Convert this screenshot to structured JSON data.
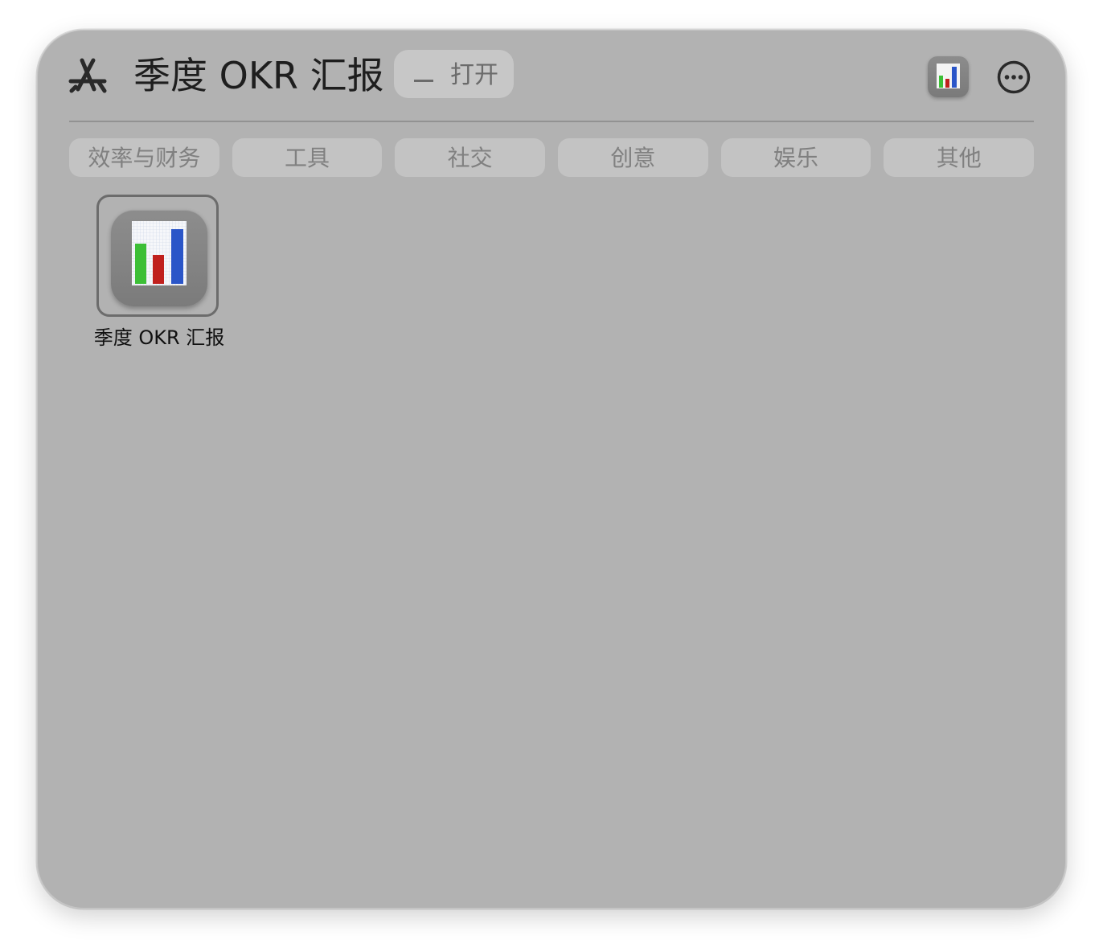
{
  "header": {
    "store_icon": "app-store-icon",
    "title": "季度 OKR 汇报",
    "open_label": "打开",
    "app_icon": "bar-chart-app-icon",
    "more_icon": "ellipsis-circle-icon"
  },
  "tabs": [
    {
      "label": "效率与财务"
    },
    {
      "label": "工具"
    },
    {
      "label": "社交"
    },
    {
      "label": "创意"
    },
    {
      "label": "娱乐"
    },
    {
      "label": "其他"
    }
  ],
  "grid": {
    "items": [
      {
        "label": "季度 OKR 汇报",
        "icon": "bar-chart-app-icon",
        "selected": true
      }
    ]
  },
  "colors": {
    "window_background": "#b2b2b2",
    "bar_green": "#3cbf36",
    "bar_red": "#c0201d",
    "bar_blue": "#2a55c8"
  }
}
